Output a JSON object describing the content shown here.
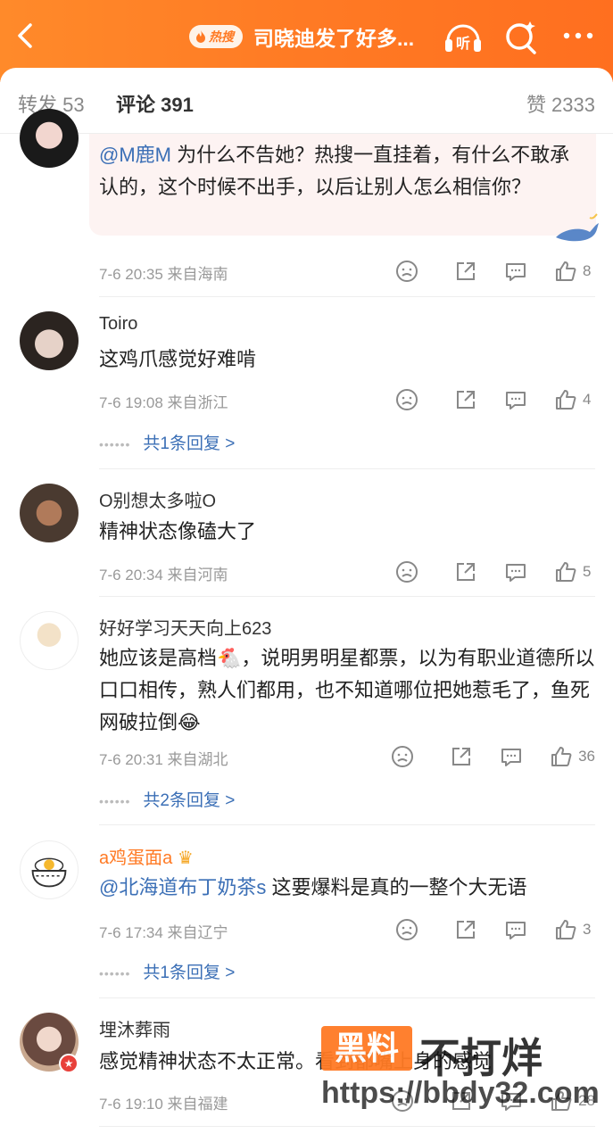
{
  "header": {
    "hot_badge": "热搜",
    "topic": "司晓迪发了好多..."
  },
  "tabs": {
    "repost": "转发 53",
    "comments": "评论 391",
    "likes": "赞 2333"
  },
  "comments": [
    {
      "mention": "@M鹿M",
      "text": " 为什么不告她？热搜一直挂着，有什么不敢承认的，这个时候不出手，以后让别人怎么相信你？",
      "meta": "7-6 20:35 来自海南",
      "likes": "8"
    },
    {
      "user": "Toiro",
      "text": "这鸡爪感觉好难啃",
      "meta": "7-6 19:08 来自浙江",
      "likes": "4",
      "replies": "共1条回复 >"
    },
    {
      "user": "O别想太多啦O",
      "text": "精神状态像磕大了",
      "meta": "7-6 20:34 来自河南",
      "likes": "5"
    },
    {
      "user": "好好学习天天向上623",
      "text_a": "她应该是高档",
      "text_b": "，说明男明星都票，以为有职业道德所以口口相传，熟人们都用，也不知道哪位把她惹毛了，鱼死网破拉倒",
      "meta": "7-6 20:31 来自湖北",
      "likes": "36",
      "replies": "共2条回复 >"
    },
    {
      "user": "a鸡蛋面a",
      "mention": "@北海道布丁奶茶s",
      "text": " 这要爆料是真的一整个大无语",
      "meta": "7-6 17:34 来自辽宁",
      "likes": "3",
      "replies": "共1条回复 >"
    },
    {
      "user": "埋沐葬雨",
      "text": "感觉精神状态不太正常。看到都嘴上身的感觉",
      "meta": "7-6 19:10 来自福建",
      "likes": "28"
    }
  ],
  "watermark": {
    "box": "黑料",
    "big": "不打烊",
    "url": "https://bbdy32.com"
  },
  "colors": {
    "brand": "#ff7a24",
    "link": "#3b6fb6"
  }
}
